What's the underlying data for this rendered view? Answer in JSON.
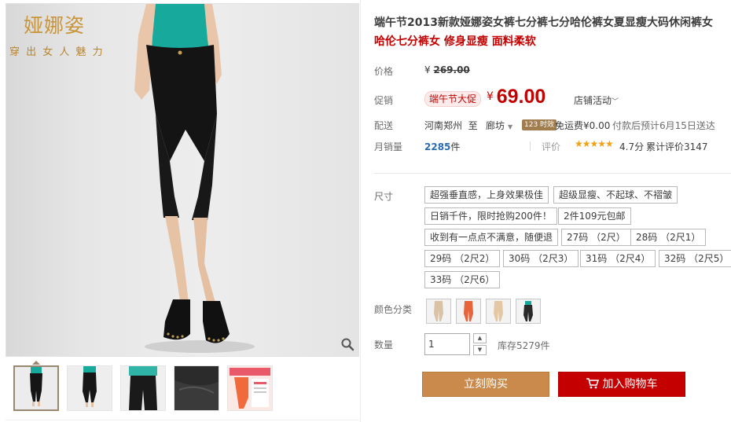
{
  "brand": {
    "name": "娅娜姿",
    "slogan": "穿 出 女 人 魅 力"
  },
  "product": {
    "title_line1": "端午节2013新款娅娜姿女裤七分裤七分哈伦裤女夏显瘦大码休闲裤女",
    "title_line2": "哈伦七分裤女 修身显瘦 面料柔软"
  },
  "price": {
    "label": "价格",
    "currency": "¥",
    "original": "269.00"
  },
  "promo": {
    "label": "促销",
    "tag": "端午节大促",
    "currency": "¥",
    "price": "69.00",
    "shop_activity": "店铺活动",
    "shop_activity_icon": "chevron-down-icon"
  },
  "shipping": {
    "label": "配送",
    "from": "河南郑州",
    "to_word": "至",
    "to": "廊坊",
    "express_badge": "123 时效",
    "fee": "免运费¥0.00",
    "eta": "付款后预计6月15日送达"
  },
  "sales": {
    "label": "月销量",
    "count": "2285",
    "unit": "件",
    "rating_label": "评价",
    "stars": "★★★★★",
    "stars_value": 4.7,
    "score": "4.7分",
    "reviews_label": "累计评价",
    "reviews_count": "3147"
  },
  "size": {
    "label": "尺寸",
    "options": [
      "超强垂直感，上身效果极佳",
      "超级显瘦、不起球、不褶皱",
      "日销千件，限时抢购200件！",
      "2件109元包邮",
      "收到有一点点不满意，随便退",
      "27码 （2尺）",
      "28码 （2尺1）",
      "29码 （2尺2）",
      "30码 （2尺3）",
      "31码 （2尺4）",
      "32码 （2尺5）",
      "33码 （2尺6）"
    ]
  },
  "colors": {
    "label": "颜色分类",
    "swatches": [
      "#d9c2a6",
      "#e8643a",
      "#e4c8a4",
      "#2a2a2a"
    ]
  },
  "quantity": {
    "label": "数量",
    "value": "1",
    "stock": "库存5279件"
  },
  "actions": {
    "buy_now": "立刻购买",
    "add_to_cart": "加入购物车"
  }
}
